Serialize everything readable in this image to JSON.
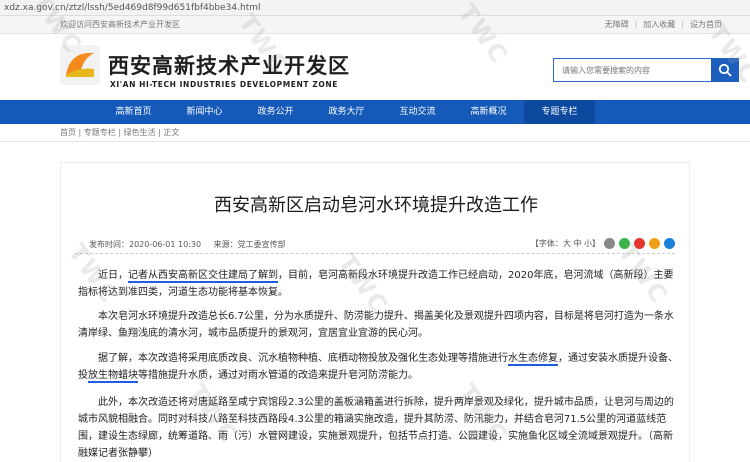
{
  "browser": {
    "url": "xdz.xa.gov.cn/ztzl/lssh/5ed469d8f99d651fbf4bbe34.html"
  },
  "topbar": {
    "welcome": "欢迎访问西安高新技术产业开发区",
    "links": [
      "无障碍",
      "加入收藏",
      "设为首页"
    ]
  },
  "header": {
    "logo_cn": "西安高新技术产业开发区",
    "logo_en": "XI'AN HI-TECH INDUSTRIES DEVELOPMENT ZONE",
    "search_placeholder": "请输入您需要搜索的内容"
  },
  "nav": {
    "items": [
      "高新首页",
      "新闻中心",
      "政务公开",
      "政务大厅",
      "互动交流",
      "高新概况",
      "专题专栏"
    ]
  },
  "breadcrumb": "首页 | 专题专栏 | 绿色生活 | 正文",
  "article": {
    "title": "西安高新区启动皂河水环境提升改造工作",
    "date": "发布时间：2020-06-01 10:30",
    "source": "来源：党工委宣传部",
    "font_label": "【字体：大 中 小】",
    "p1_a": "近日，",
    "p1_hl": "记者从西安高新区交住建局了解到",
    "p1_b": "，目前，皂河高新段水环境提升改造工作已经启动，2020年底，皂河流域（高新段）主要指标将达到准四类，河道生态功能将基本恢复。",
    "p2": "本次皂河水环境提升改造总长6.7公里，分为水质提升、防涝能力提升、揭盖美化及景观提升四项内容，目标是将皂河打造为一条水清岸绿、鱼翔浅底的清水河，城市品质提升的景观河，宜居宜业宜游的民心河。",
    "p3_a": "据了解，本次改造将采用底质改良、沉水植物种植、底栖动物投放及强化生态处理等措施进行",
    "p3_hl1": "水生态修复",
    "p3_b": "，通过安装水质提升设备、投",
    "p3_hl2": "放生物蜡块",
    "p3_c": "等措施提升水质，通过对雨水管道的改造来提升皂河防涝能力。",
    "p4": "此外，本次改造还将对唐延路至咸宁宾馆段2.3公里的盖板涵箱盖进行拆除，提升两岸景观及绿化，提升城市品质，让皂河与周边的城市风貌相融合。同时对科技八路至科技西路段4.3公里的箱涵实施改造，提升其防涝、防汛能力，并结合皂河71.5公里的河道蓝线范围，建设生态绿廊，统筹道路、雨（污）水管网建设，实施景观提升，包括节点打造、公园建设，实施鱼化区域全流域景观提升。（高新融媒记者张静攀）"
  },
  "watermark_text": "TWC",
  "colors": {
    "nav_bg": "#1559b9",
    "highlight": "#1d5fe0"
  }
}
